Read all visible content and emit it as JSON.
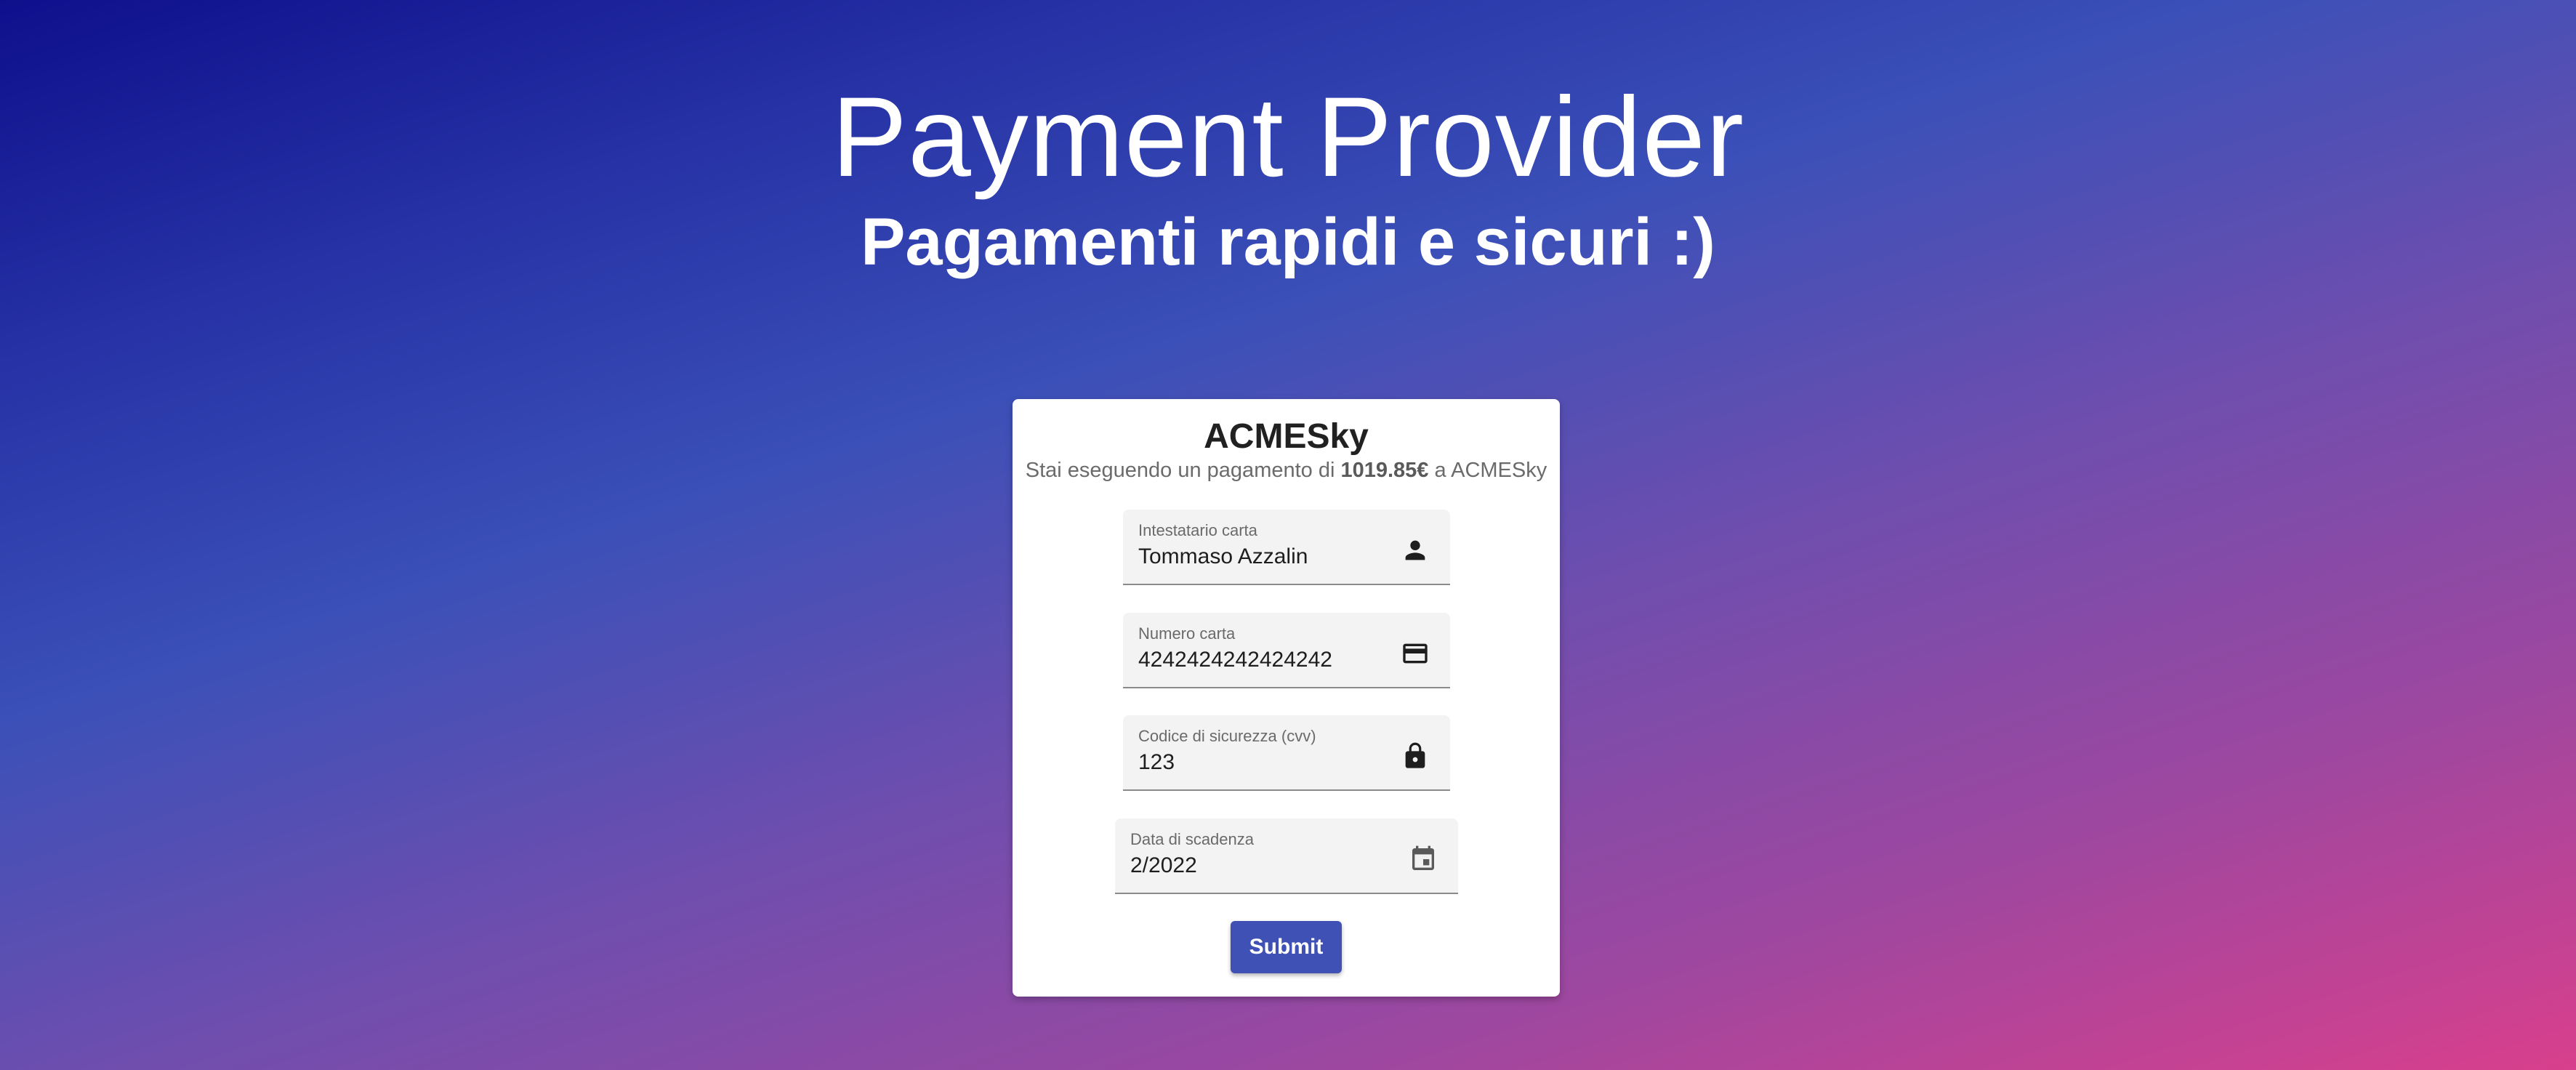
{
  "header": {
    "title": "Payment Provider",
    "subtitle": "Pagamenti rapidi e sicuri :)"
  },
  "card": {
    "merchant": "ACMESky",
    "description_prefix": "Stai eseguendo un pagamento di",
    "amount": "1019.85€",
    "description_suffix": "a ACMESky"
  },
  "form": {
    "holder": {
      "label": "Intestatario carta",
      "value": "Tommaso Azzalin",
      "icon": "person-icon"
    },
    "card_number": {
      "label": "Numero carta",
      "value": "4242424242424242",
      "icon": "credit-card-icon"
    },
    "cvv": {
      "label": "Codice di sicurezza (cvv)",
      "value": "123",
      "icon": "lock-icon"
    },
    "expiry": {
      "label": "Data di scadenza",
      "value": "2/2022",
      "icon": "calendar-icon"
    },
    "submit_label": "Submit"
  },
  "colors": {
    "primary": "#3f51b5",
    "field_background": "#f3f3f3"
  }
}
